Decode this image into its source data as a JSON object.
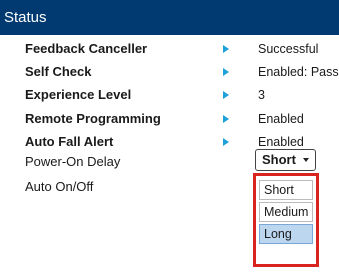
{
  "panel": {
    "title": "Status"
  },
  "rows": [
    {
      "label": "Feedback Canceller",
      "value": "Successful"
    },
    {
      "label": "Self Check",
      "value": "Enabled: Pass"
    },
    {
      "label": "Experience Level",
      "value": "3"
    },
    {
      "label": "Remote Programming",
      "value": "Enabled"
    },
    {
      "label": "Auto Fall Alert",
      "value": "Enabled"
    }
  ],
  "settings": {
    "power_on_delay": {
      "label": "Power-On Delay",
      "selected": "Short",
      "options": [
        "Short",
        "Medium",
        "Long"
      ],
      "highlighted_option": "Long"
    },
    "auto_on_off": {
      "label": "Auto On/Off"
    }
  },
  "colors": {
    "header_bg": "#003a70",
    "arrow": "#1ea0d8",
    "highlight_border": "#d9231f",
    "option_highlight": "#bcd6ef"
  },
  "icons": {
    "row_arrow": "triangle-right-icon",
    "select_caret": "caret-down-icon"
  }
}
